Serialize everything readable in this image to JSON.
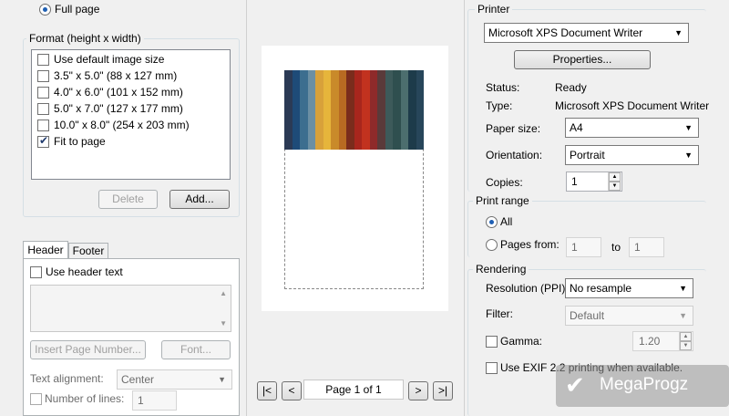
{
  "left": {
    "full_page_label": "Full page",
    "format_legend": "Format (height x width)",
    "format_items": [
      {
        "label": "Use default image size",
        "checked": false
      },
      {
        "label": "3.5\" x 5.0\" (88 x 127 mm)",
        "checked": false
      },
      {
        "label": "4.0\" x 6.0\" (101 x 152 mm)",
        "checked": false
      },
      {
        "label": "5.0\" x 7.0\" (127 x 177 mm)",
        "checked": false
      },
      {
        "label": "10.0\" x 8.0\" (254 x 203 mm)",
        "checked": false
      },
      {
        "label": "Fit to page",
        "checked": true
      }
    ],
    "delete_label": "Delete",
    "add_label": "Add...",
    "tabs": [
      "Header",
      "Footer"
    ],
    "use_header_text": "Use header text",
    "insert_page_number": "Insert Page Number...",
    "font_label": "Font...",
    "text_alignment_label": "Text alignment:",
    "text_alignment_value": "Center",
    "number_of_lines_label": "Number of lines:",
    "number_of_lines_value": "1"
  },
  "preview": {
    "first": "|<",
    "prev": "<",
    "page_text": "Page 1 of 1",
    "next": ">",
    "last": ">|",
    "stripe_colors": [
      "#2b3a55",
      "#1e4b78",
      "#3c6e8f",
      "#6b8fa3",
      "#d8a13a",
      "#e6b53b",
      "#c98a2a",
      "#b86a22",
      "#7a2c1c",
      "#a8261d",
      "#c2321f",
      "#8e2a2a",
      "#5a3a3a",
      "#3d5a5a",
      "#2f4f4f",
      "#4c6e6e",
      "#1d3b4a",
      "#27465a"
    ]
  },
  "right": {
    "printer_legend": "Printer",
    "printer_name": "Microsoft XPS Document Writer",
    "properties_label": "Properties...",
    "status_label": "Status:",
    "status_value": "Ready",
    "type_label": "Type:",
    "type_value": "Microsoft XPS Document Writer",
    "paper_size_label": "Paper size:",
    "paper_size_value": "A4",
    "orientation_label": "Orientation:",
    "orientation_value": "Portrait",
    "copies_label": "Copies:",
    "copies_value": "1",
    "print_range_legend": "Print range",
    "all_label": "All",
    "pages_from_label": "Pages from:",
    "pages_from_value": "1",
    "to_label": "to",
    "pages_to_value": "1",
    "rendering_legend": "Rendering",
    "resolution_label": "Resolution (PPI):",
    "resolution_value": "No resample",
    "filter_label": "Filter:",
    "filter_value": "Default",
    "gamma_label": "Gamma:",
    "gamma_value": "1.20",
    "exif_label": "Use EXIF 2.2 printing when available."
  },
  "watermark": "MegaProgz"
}
